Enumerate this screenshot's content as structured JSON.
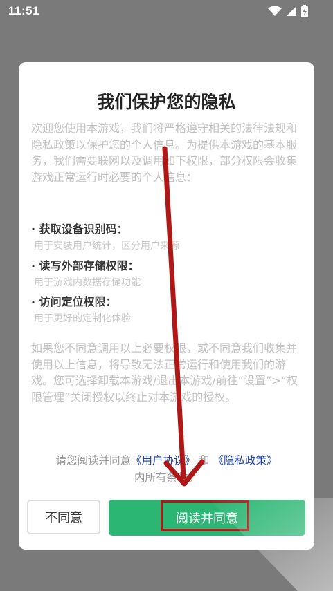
{
  "status_bar": {
    "time": "11:51",
    "icons": [
      "wifi-icon",
      "signal-icon",
      "battery-charging-icon"
    ]
  },
  "dialog": {
    "title": "我们保护您的隐私",
    "intro": "欢迎您使用本游戏，我们将严格遵守相关的法律法规和隐私政策以保护您的个人信息。为提供本游戏的基本服务，我们需要联网以及调用如下权限，部分权限会收集游戏正常运行时必要的个人信息：",
    "permissions": [
      {
        "title": "· 获取设备识别码：",
        "desc": "用于安装用户统计，区分用户来源"
      },
      {
        "title": "· 读写外部存储权限：",
        "desc": "用于游戏内数据存储功能"
      },
      {
        "title": "· 访问定位权限：",
        "desc": "用于更好的定制化体验"
      }
    ],
    "notice": "如果您不同意调用以上必要权限，或不同意我们收集并使用以上信息，将导致无法正常运行和使用我们的游戏。您可选择卸载本游戏/退出本游戏/前往“设置”>“权限管理”关闭授权以终止对本游戏的授权。",
    "agree_prefix": "请您阅读并同意",
    "user_agreement": "《用户协议》",
    "and": "和",
    "privacy_policy": "《隐私政策》",
    "agree_suffix": "内所有条款。",
    "disagree_button": "不同意",
    "agree_button": "阅读并同意"
  },
  "colors": {
    "accent_green": "#2bb673",
    "link_blue": "#1d3fa8",
    "annotation_red": "#b01818"
  }
}
